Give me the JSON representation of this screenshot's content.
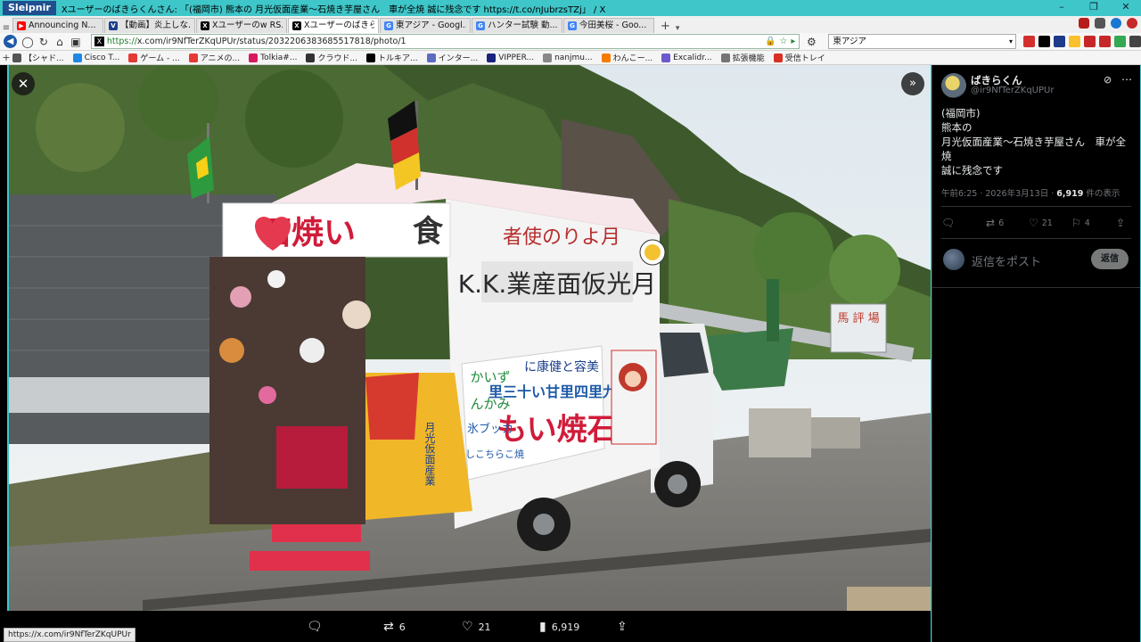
{
  "browser": {
    "app_name": "Sleipnir",
    "window_title": "Xユーザーのばきらくんさん: 「(福岡市) 熊本の 月光仮面産業〜石焼き芋屋さん　車が全焼 誠に残念です https://t.co/nJubrzsTZj」 / X",
    "tabs": [
      {
        "label": "Announcing N...",
        "fav_color": "#ff0000",
        "fav": "▶"
      },
      {
        "label": "【動画】炎上しな...",
        "fav_color": "#1a3e8c",
        "fav": "V"
      },
      {
        "label": "Xユーザーのw RS...",
        "fav_color": "#000000",
        "fav": "X"
      },
      {
        "label": "Xユーザーのばきら...",
        "fav_color": "#000000",
        "fav": "X"
      },
      {
        "label": "東アジア - Googl...",
        "fav_color": "#4285f4",
        "fav": "G"
      },
      {
        "label": "ハンター試験 動...",
        "fav_color": "#4285f4",
        "fav": "G"
      },
      {
        "label": "今田美桜 - Goo...",
        "fav_color": "#4285f4",
        "fav": "G"
      }
    ],
    "url": {
      "scheme": "https://",
      "rest": "x.com/ir9NfTerZKqUPUr/status/2032206383685517818/photo/1"
    },
    "search_value": "東アジア",
    "bookmarks": [
      {
        "label": "【シャド...",
        "color": "#555555"
      },
      {
        "label": "Cisco T...",
        "color": "#1e88e5"
      },
      {
        "label": "ゲーム - ...",
        "color": "#e53935"
      },
      {
        "label": "アニメの...",
        "color": "#e53935"
      },
      {
        "label": "Tolkia#...",
        "color": "#d81b60"
      },
      {
        "label": "クラウド...",
        "color": "#333333"
      },
      {
        "label": "トルキア...",
        "color": "#000000"
      },
      {
        "label": "インター...",
        "color": "#5c6bc0"
      },
      {
        "label": "VIPPER...",
        "color": "#1a237e"
      },
      {
        "label": "nanjmu...",
        "color": "#888888"
      },
      {
        "label": "わんこー...",
        "color": "#f57c00"
      },
      {
        "label": "Excalidr...",
        "color": "#6a5acd"
      },
      {
        "label": "拡張機能",
        "color": "#757575"
      },
      {
        "label": "受信トレイ",
        "color": "#d93025"
      }
    ],
    "status_url": "https://x.com/ir9NfTerZKqUPUr"
  },
  "viewer": {
    "close_icon": "✕",
    "expand_icon": "»",
    "actions": {
      "reply_count": "",
      "repost_count": "6",
      "like_count": "21",
      "views_count": "6,919"
    }
  },
  "tweet": {
    "display_name": "ばきらくん",
    "handle": "@ir9NfTerZKqUPUr",
    "lines": [
      "(福岡市)",
      "熊本の",
      "月光仮面産業〜石焼き芋屋さん　車が全焼",
      "誠に残念です"
    ],
    "time": "午前6:25 · 2026年3月13日 · ",
    "views_number": "6,919",
    "views_suffix": " 件の表示",
    "stats": {
      "reply": "",
      "repost": "6",
      "like": "21",
      "bookmark": "4"
    },
    "reply_placeholder": "返信をポスト",
    "reply_button": "返信"
  },
  "truck_signs": {
    "roof_left": "石焼い",
    "roof_right": "食",
    "top_red": "者使のりよ月",
    "top_black": "K.K.業産面仮光月",
    "side_a": "里三十い甘里四里九",
    "side_b": "もい焼石",
    "side_c": "に康健と容美",
    "side_d": "かいず",
    "side_e": "んかみ",
    "side_f": "氷ブッカ",
    "side_g": "しこちらこ焼",
    "banner_yellow": "月光仮面産業",
    "bg_sign": "馬 評 場"
  },
  "colors": {
    "accent": "#3fc6c9",
    "x_black": "#000000",
    "x_text": "#e7e9ea",
    "x_muted": "#71767b"
  }
}
